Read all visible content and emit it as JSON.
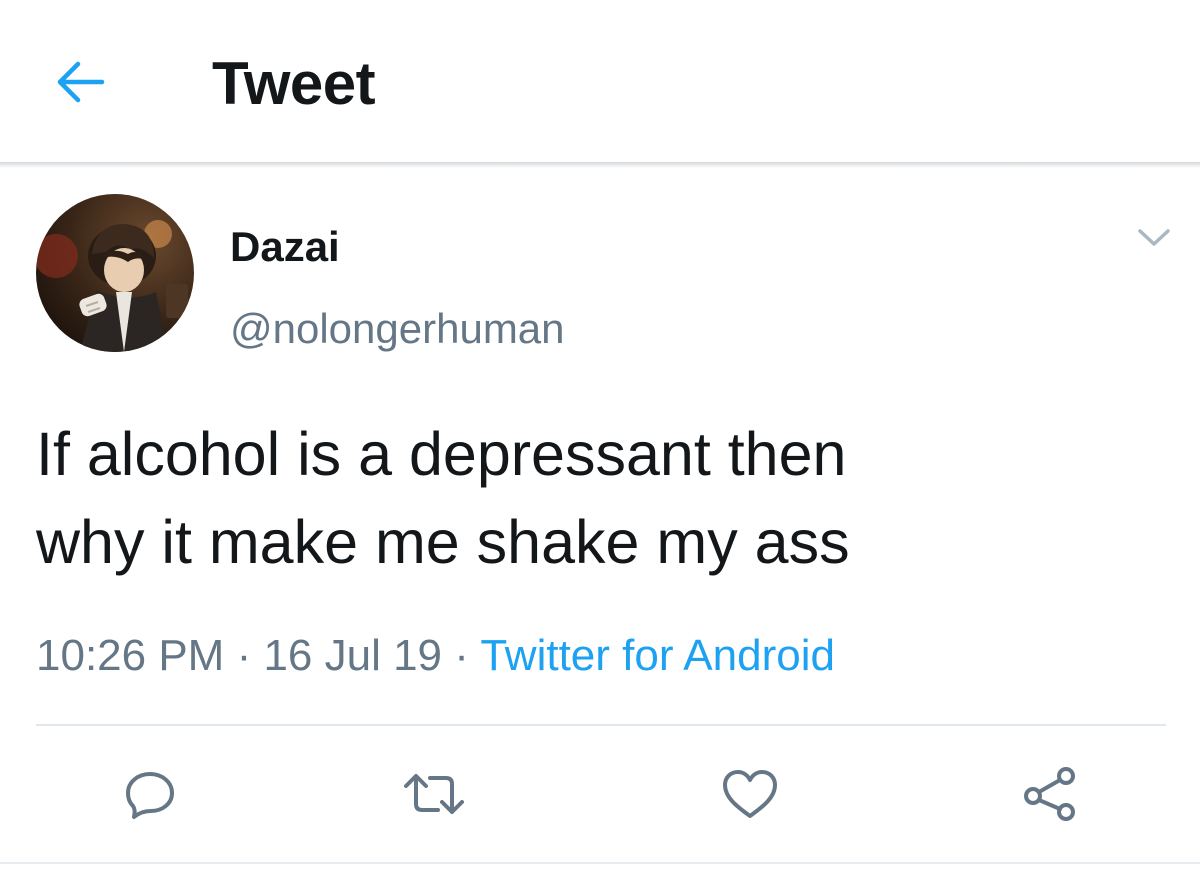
{
  "header": {
    "title": "Tweet",
    "back_icon": "back-arrow-icon"
  },
  "tweet": {
    "author": {
      "display_name": "Dazai",
      "handle": "@nolongerhuman"
    },
    "text_lines": [
      "If alcohol is a depressant then",
      "why it make me shake my ass"
    ],
    "time": "10:26 PM",
    "separator": " · ",
    "date": "16 Jul 19",
    "source": "Twitter for Android",
    "menu_icon": "chevron-down-icon"
  },
  "actions": [
    {
      "name": "reply",
      "icon": "reply-icon"
    },
    {
      "name": "retweet",
      "icon": "retweet-icon"
    },
    {
      "name": "like",
      "icon": "heart-icon"
    },
    {
      "name": "share",
      "icon": "share-icon"
    }
  ],
  "colors": {
    "accent": "#1da1f2",
    "text_primary": "#14171a",
    "text_secondary": "#657786",
    "icon_gray": "#657786",
    "divider": "#e1e8ed"
  }
}
